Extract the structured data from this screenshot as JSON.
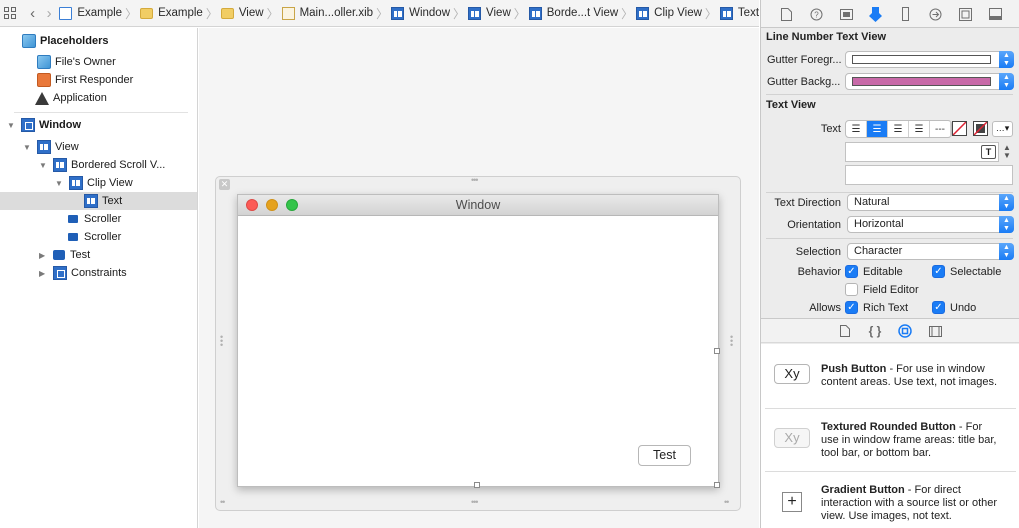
{
  "jumpbar": {
    "crumbs": [
      "Example",
      "Example",
      "View",
      "Main...oller.xib",
      "Window",
      "View",
      "Borde...t View",
      "Clip View",
      "Text"
    ]
  },
  "outline": {
    "placeholders": "Placeholders",
    "files_owner": "File's Owner",
    "first_responder": "First Responder",
    "application": "Application",
    "window": "Window",
    "view": "View",
    "bordered_scroll": "Bordered Scroll V...",
    "clip_view": "Clip View",
    "text": "Text",
    "scroller1": "Scroller",
    "scroller2": "Scroller",
    "test": "Test",
    "constraints": "Constraints"
  },
  "canvas": {
    "window_title": "Window",
    "test_button": "Test"
  },
  "inspector": {
    "line_number_section": "Line Number Text View",
    "gutter_fg_label": "Gutter Foregr...",
    "gutter_bg_label": "Gutter Backg...",
    "gutter_fg_color": "#ffffff",
    "gutter_bg_color": "#c869a8",
    "text_view_section": "Text View",
    "text_label": "Text",
    "text_direction_label": "Text Direction",
    "text_direction_value": "Natural",
    "orientation_label": "Orientation",
    "orientation_value": "Horizontal",
    "selection_label": "Selection",
    "selection_value": "Character",
    "behavior_label": "Behavior",
    "editable": "Editable",
    "selectable": "Selectable",
    "field_editor": "Field Editor",
    "allows_label": "Allows",
    "rich_text": "Rich Text",
    "undo": "Undo"
  },
  "library": {
    "items": [
      {
        "icon_text": "Xy",
        "title": "Push Button",
        "desc": " - For use in window content areas. Use text, not images."
      },
      {
        "icon_text": "Xy",
        "title": "Textured Rounded Button",
        "desc": " - For use in window frame areas: title bar, tool bar, or bottom bar."
      },
      {
        "icon_text": "+",
        "title": "Gradient Button",
        "desc": " - For direct interaction with a source list or other view. Use images, not text."
      }
    ]
  }
}
